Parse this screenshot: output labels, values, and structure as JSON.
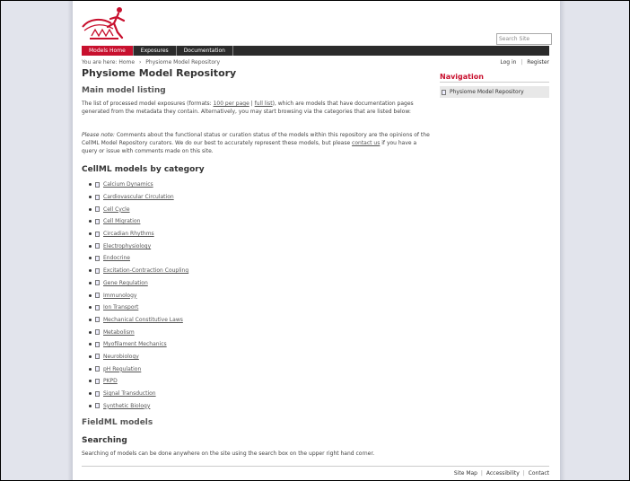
{
  "header": {
    "logo": "physiome-logo",
    "search": {
      "placeholder": "Search Site"
    }
  },
  "nav_tabs": [
    {
      "label": "Models Home",
      "active": true
    },
    {
      "label": "Exposures",
      "active": false
    },
    {
      "label": "Documentation",
      "active": false
    }
  ],
  "breadcrumb": {
    "prefix": "You are here:",
    "home": "Home",
    "separator": "›",
    "current": "Physiome Model Repository"
  },
  "user_links": {
    "login": "Log in",
    "register": "Register",
    "divider": "|"
  },
  "main": {
    "title": "Physiome Model Repository",
    "listing_heading": "Main model listing",
    "listing_text_1": "The list of processed model exposures (formats: ",
    "link_100": "100 per page",
    "link_sep": " | ",
    "link_full": "full list",
    "listing_text_2": "), which are models that have documentation pages generated from the metadata they contain. Alternatively, you may start browsing via the categories that are listed below:",
    "note_label": "Please note:",
    "note_text_1": " Comments about the functional status or curation status of the models within this repository are the opinions of the CellML Model Repository curators. We do our best to accurately represent these models, but please ",
    "note_link": "contact us",
    "note_text_2": " if you have a query or issue with comments made on this site.",
    "cellml_heading": "CellML models by category",
    "categories": [
      "Calcium Dynamics",
      "Cardiovascular Circulation",
      "Cell Cycle",
      "Cell Migration",
      "Circadian Rhythms",
      "Electrophysiology",
      "Endocrine",
      "Excitation-Contraction Coupling",
      "Gene Regulation",
      "Immunology",
      "Ion Transport",
      "Mechanical Constitutive Laws",
      "Metabolism",
      "Myofilament Mechanics",
      "Neurobiology",
      "pH Regulation",
      "PKPD",
      "Signal Transduction",
      "Synthetic Biology"
    ],
    "fieldml_heading": "FieldML models",
    "searching_heading": "Searching",
    "searching_text": "Searching of models can be done anywhere on the site using the search box on the upper right hand corner."
  },
  "navigation": {
    "heading": "Navigation",
    "item": "Physiome Model Repository"
  },
  "footer": {
    "sitemap": "Site Map",
    "accessibility": "Accessibility",
    "contact": "Contact",
    "divider": "|"
  },
  "colors": {
    "brand_red": "#c8102e",
    "navbar": "#2b2b2b"
  }
}
